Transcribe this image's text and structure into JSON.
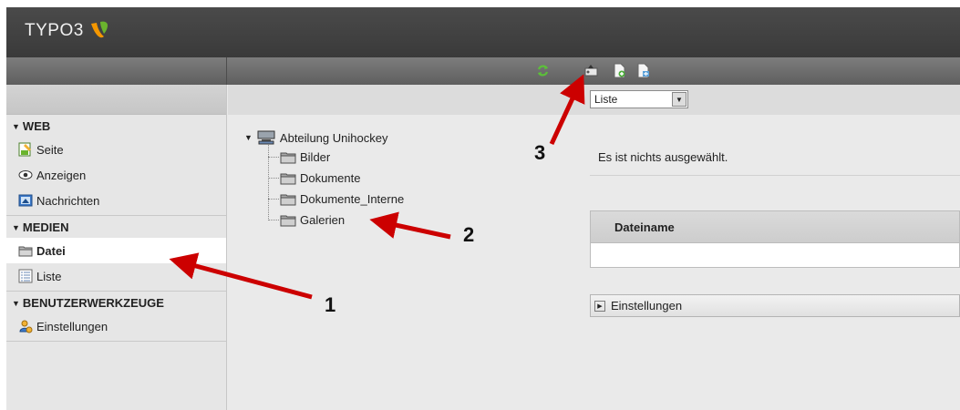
{
  "header": {
    "logo_text": "TYPO3"
  },
  "toolbar": {
    "icons": [
      "refresh-icon",
      "upload-icon",
      "new-file-icon",
      "new-folder-icon"
    ]
  },
  "module_menu": {
    "groups": [
      {
        "title": "WEB",
        "items": [
          {
            "label": "Seite",
            "icon": "page-edit-icon"
          },
          {
            "label": "Anzeigen",
            "icon": "eye-icon"
          },
          {
            "label": "Nachrichten",
            "icon": "news-icon"
          }
        ]
      },
      {
        "title": "MEDIEN",
        "items": [
          {
            "label": "Datei",
            "icon": "folder-icon",
            "active": true
          },
          {
            "label": "Liste",
            "icon": "list-icon"
          }
        ]
      },
      {
        "title": "BENUTZERWERKZEUGE",
        "items": [
          {
            "label": "Einstellungen",
            "icon": "user-settings-icon"
          }
        ]
      }
    ]
  },
  "tree": {
    "root": "Abteilung Unihockey",
    "children": [
      "Bilder",
      "Dokumente",
      "Dokumente_Interne",
      "Galerien"
    ]
  },
  "content": {
    "view_select": {
      "value": "Liste"
    },
    "no_selection": "Es ist nichts ausgewählt.",
    "table": {
      "columns": [
        "Dateiname"
      ]
    },
    "settings_label": "Einstellungen"
  },
  "annotations": {
    "labels": [
      "1",
      "2",
      "3"
    ],
    "color": "#cc0000"
  }
}
